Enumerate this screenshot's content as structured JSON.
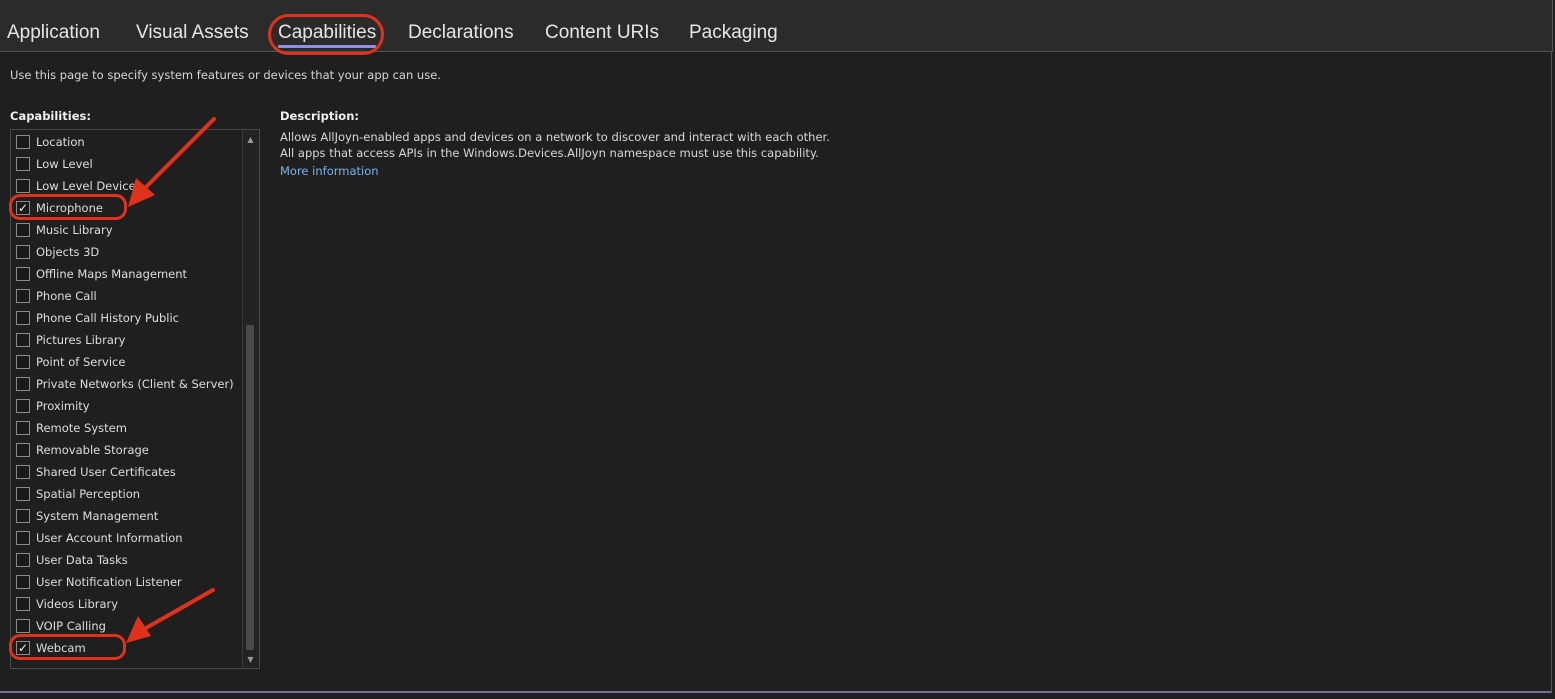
{
  "tabs": [
    {
      "label": "Application",
      "active": false
    },
    {
      "label": "Visual Assets",
      "active": false
    },
    {
      "label": "Capabilities",
      "active": true
    },
    {
      "label": "Declarations",
      "active": false
    },
    {
      "label": "Content URIs",
      "active": false
    },
    {
      "label": "Packaging",
      "active": false
    }
  ],
  "intro_text": "Use this page to specify system features or devices that your app can use.",
  "capabilities_heading": "Capabilities:",
  "description_heading": "Description:",
  "description_text": "Allows AllJoyn-enabled apps and devices on a network to discover and interact with each other. All apps that access APIs in the Windows.Devices.AllJoyn namespace must use this capability.",
  "more_info_link": "More information",
  "capabilities": [
    {
      "label": "Location",
      "checked": false
    },
    {
      "label": "Low Level",
      "checked": false
    },
    {
      "label": "Low Level Devices",
      "checked": false
    },
    {
      "label": "Microphone",
      "checked": true
    },
    {
      "label": "Music Library",
      "checked": false
    },
    {
      "label": "Objects 3D",
      "checked": false
    },
    {
      "label": "Offline Maps Management",
      "checked": false
    },
    {
      "label": "Phone Call",
      "checked": false
    },
    {
      "label": "Phone Call History Public",
      "checked": false
    },
    {
      "label": "Pictures Library",
      "checked": false
    },
    {
      "label": "Point of Service",
      "checked": false
    },
    {
      "label": "Private Networks (Client & Server)",
      "checked": false
    },
    {
      "label": "Proximity",
      "checked": false
    },
    {
      "label": "Remote System",
      "checked": false
    },
    {
      "label": "Removable Storage",
      "checked": false
    },
    {
      "label": "Shared User Certificates",
      "checked": false
    },
    {
      "label": "Spatial Perception",
      "checked": false
    },
    {
      "label": "System Management",
      "checked": false
    },
    {
      "label": "User Account Information",
      "checked": false
    },
    {
      "label": "User Data Tasks",
      "checked": false
    },
    {
      "label": "User Notification Listener",
      "checked": false
    },
    {
      "label": "Videos Library",
      "checked": false
    },
    {
      "label": "VOIP Calling",
      "checked": false
    },
    {
      "label": "Webcam",
      "checked": true
    }
  ],
  "colors": {
    "annotation_red": "#e0321b",
    "active_tab_underline": "#8f8fe8",
    "link": "#7cb3ea",
    "background": "#1f1f1f"
  },
  "icons": {
    "checkmark": "check-icon",
    "scroll_up": "chevron-up-icon",
    "scroll_down": "chevron-down-icon",
    "annotation": "red-arrow-icon"
  }
}
